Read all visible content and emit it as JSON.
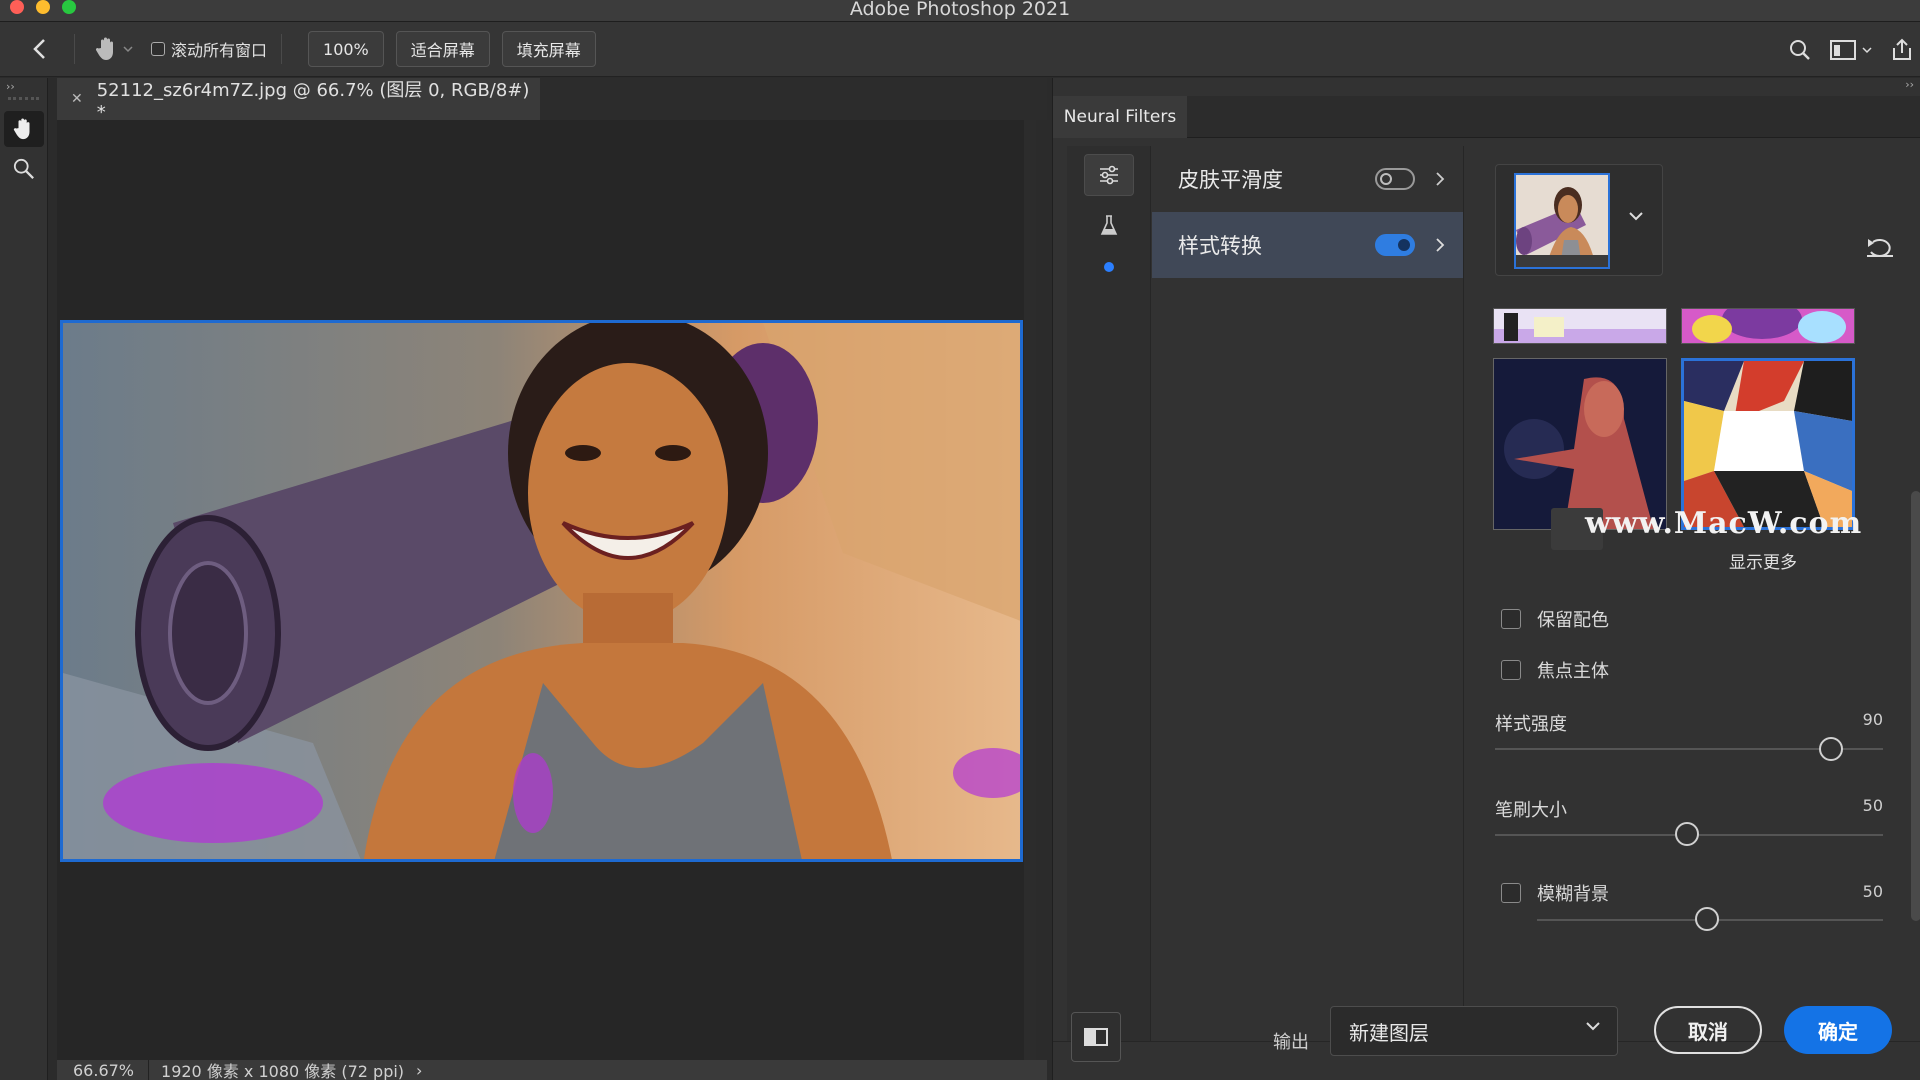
{
  "window": {
    "title": "Adobe Photoshop 2021"
  },
  "options_bar": {
    "scroll_all_label": "滚动所有窗口",
    "zoom_100_label": "100%",
    "fit_screen_label": "适合屏幕",
    "fill_screen_label": "填充屏幕"
  },
  "document": {
    "tab_title": "52112_sz6r4m7Z.jpg @ 66.7% (图层 0, RGB/8#) *",
    "status_zoom": "66.67%",
    "status_info": "1920 像素 x 1080 像素 (72 ppi)"
  },
  "neural_filters": {
    "tab_label": "Neural Filters",
    "filters": [
      {
        "name": "皮肤平滑度",
        "enabled": false
      },
      {
        "name": "样式转换",
        "enabled": true
      }
    ],
    "show_more_label": "显示更多",
    "watermark": "www.MacW.com",
    "options": {
      "preserve_color_label": "保留配色",
      "focus_subject_label": "焦点主体",
      "style_strength_label": "样式强度",
      "style_strength_value": "90",
      "brush_size_label": "笔刷大小",
      "brush_size_value": "50",
      "blur_background_label": "模糊背景",
      "blur_background_value": "50"
    },
    "footer": {
      "output_label": "输出",
      "output_value": "新建图层",
      "cancel_label": "取消",
      "ok_label": "确定"
    }
  },
  "colors": {
    "accent": "#1473e6",
    "selection_border": "#1e6ad1",
    "selected_row": "#404857"
  }
}
